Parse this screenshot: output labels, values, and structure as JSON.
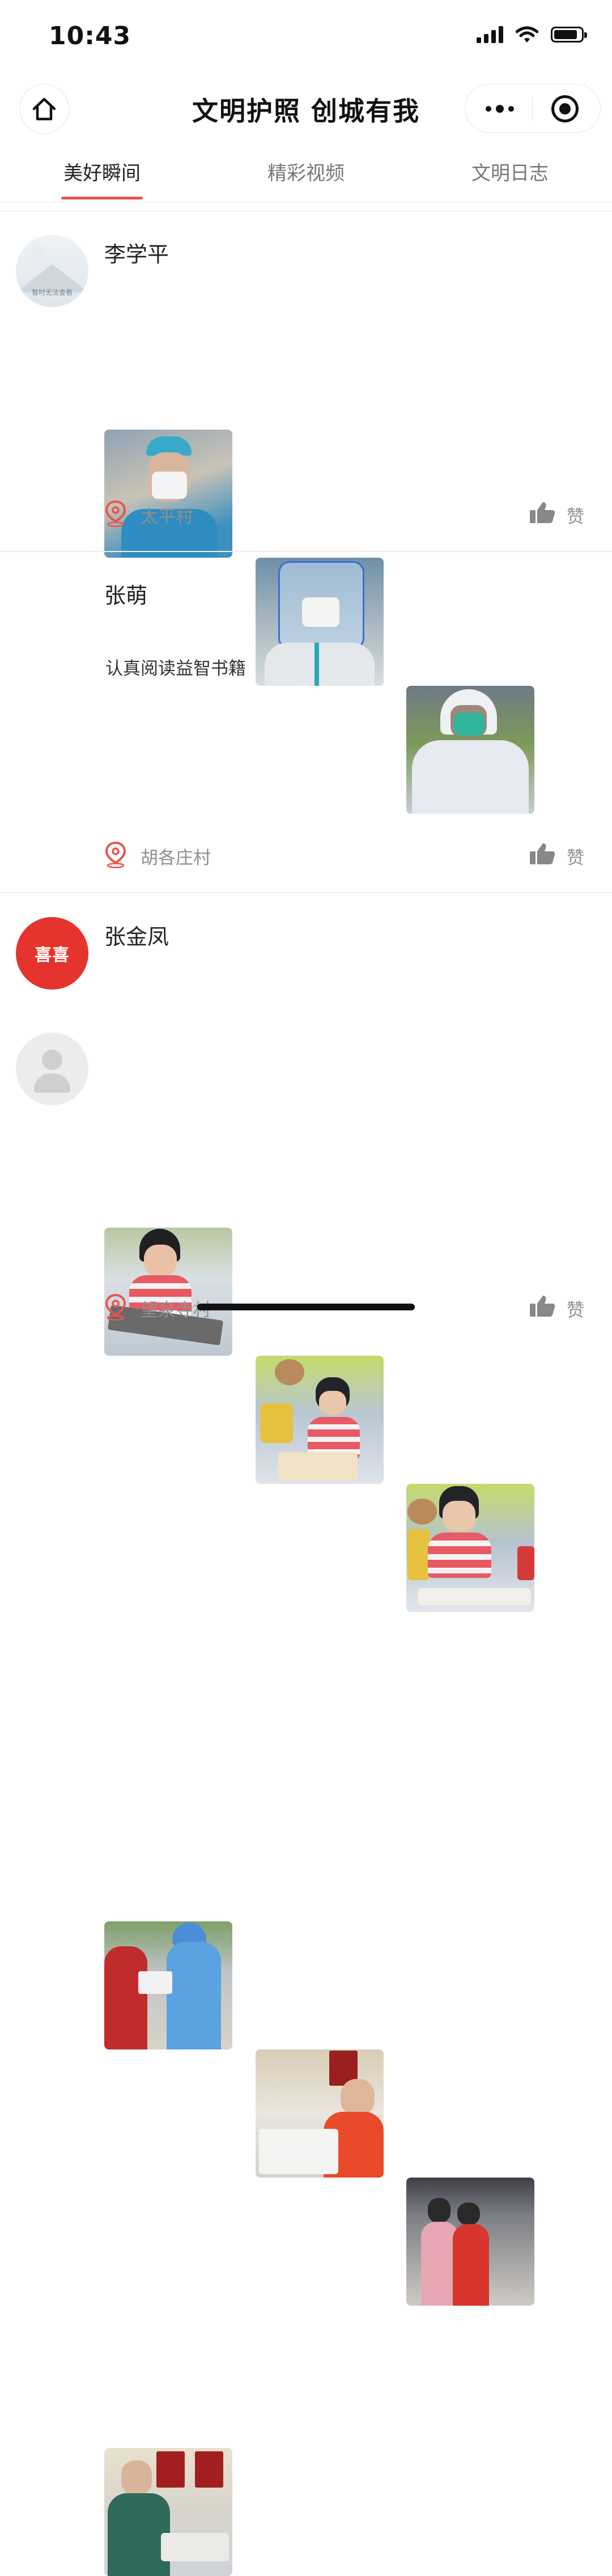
{
  "status": {
    "time": "10:43"
  },
  "header": {
    "title": "文明护照 创城有我"
  },
  "tabs": [
    {
      "label": "美好瞬间",
      "active": true
    },
    {
      "label": "精彩视频",
      "active": false
    },
    {
      "label": "文明日志",
      "active": false
    }
  ],
  "posts": [
    {
      "name": "李学平",
      "avatar_caption": "暂时无法查看",
      "text": "",
      "photos": [
        "nurse-in-mask-selfie",
        "face-shield-ppe-selfie",
        "protective-suit-selfie"
      ],
      "location": "太平村",
      "like_label": "赞"
    },
    {
      "name": "张萌",
      "text": "认真阅读益智书籍",
      "photos": [
        "child-reading-book-1",
        "child-reading-book-2",
        "child-reading-book-3"
      ],
      "location": "胡各庄村",
      "like_label": "赞"
    },
    {
      "name": "张金凤",
      "avatar_text": "喜喜",
      "text": "",
      "photos": [
        "volunteers-registering-outdoors",
        "woman-at-desk-writing",
        "women-checking-phones",
        "woman-at-counter-office"
      ],
      "location": "望泉寺村",
      "like_label": "赞"
    }
  ],
  "colors": {
    "accent": "#e8554e",
    "avatar_red": "#e5332d"
  }
}
